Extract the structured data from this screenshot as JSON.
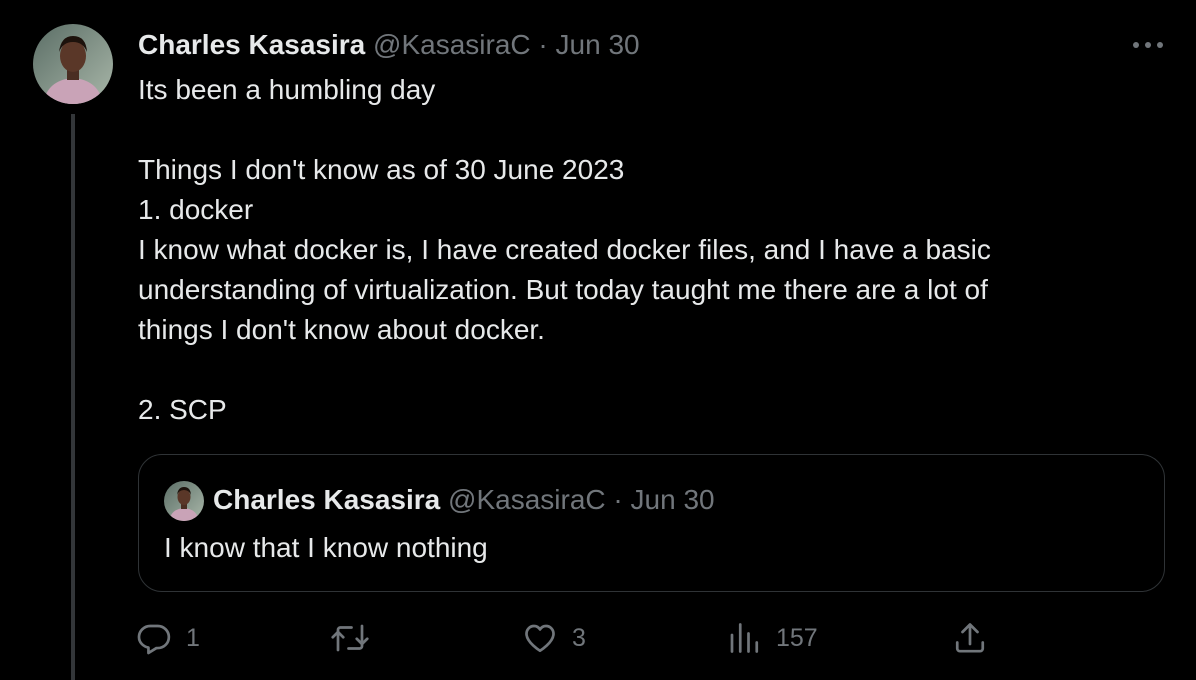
{
  "tweet": {
    "author_name": "Charles Kasasira",
    "handle": "@KasasiraC",
    "separator": "·",
    "date": "Jun 30",
    "text_lines": [
      "Its been a humbling day",
      "",
      "Things I don't know as of 30 June 2023",
      "1. docker",
      "I know what docker is, I have created docker files, and I have a basic",
      "understanding of virtualization. But today taught me there are a lot of",
      "things I don't know about docker.",
      "",
      "2. SCP"
    ]
  },
  "quoted_tweet": {
    "author_name": "Charles Kasasira",
    "handle": "@KasasiraC",
    "separator": "·",
    "date": "Jun 30",
    "text": "I know that I know nothing"
  },
  "actions": {
    "reply_count": "1",
    "retweet_count": "",
    "like_count": "3",
    "views_count": "157"
  },
  "icons": {
    "more": "more-horizontal-icon",
    "reply": "reply-icon",
    "retweet": "retweet-icon",
    "like": "heart-icon",
    "views": "views-chart-icon",
    "share": "share-icon"
  },
  "colors": {
    "background": "#000000",
    "text_primary": "#e7e9ea",
    "text_secondary": "#71767b",
    "border": "#2f3336"
  }
}
